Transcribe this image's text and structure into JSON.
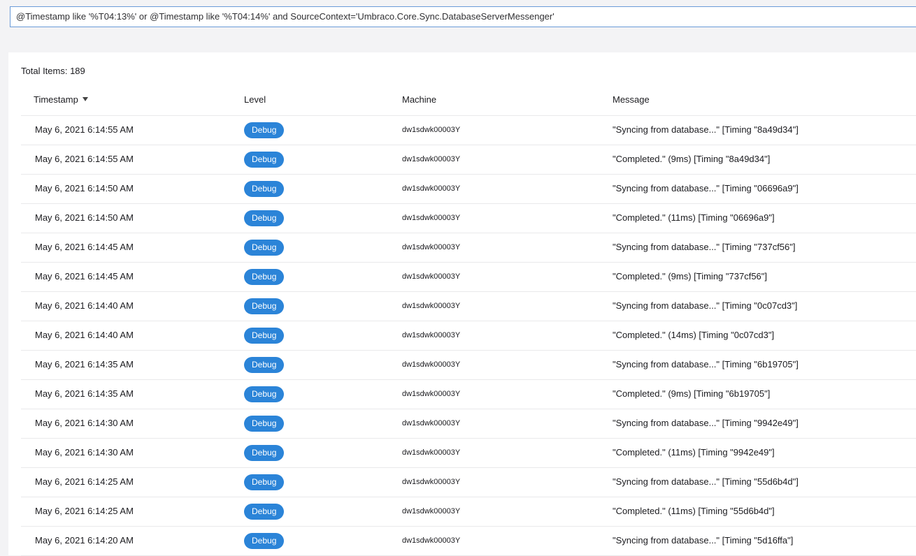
{
  "query": {
    "value": "@Timestamp like '%T04:13%' or @Timestamp like '%T04:14%' and SourceContext='Umbraco.Core.Sync.DatabaseServerMessenger'"
  },
  "total_items": "Total Items: 189",
  "columns": {
    "timestamp": "Timestamp",
    "level": "Level",
    "machine": "Machine",
    "message": "Message",
    "sort_icon": "caret-down-icon"
  },
  "colors": {
    "badge_debug": "#2b84d8",
    "query_border": "#6a9bd8"
  },
  "rows": [
    {
      "timestamp": "May 6, 2021 6:14:55 AM",
      "level": "Debug",
      "machine": "dw1sdwk00003Y",
      "message": "\"Syncing from database...\" [Timing \"8a49d34\"]"
    },
    {
      "timestamp": "May 6, 2021 6:14:55 AM",
      "level": "Debug",
      "machine": "dw1sdwk00003Y",
      "message": "\"Completed.\" (9ms) [Timing \"8a49d34\"]"
    },
    {
      "timestamp": "May 6, 2021 6:14:50 AM",
      "level": "Debug",
      "machine": "dw1sdwk00003Y",
      "message": "\"Syncing from database...\" [Timing \"06696a9\"]"
    },
    {
      "timestamp": "May 6, 2021 6:14:50 AM",
      "level": "Debug",
      "machine": "dw1sdwk00003Y",
      "message": "\"Completed.\" (11ms) [Timing \"06696a9\"]"
    },
    {
      "timestamp": "May 6, 2021 6:14:45 AM",
      "level": "Debug",
      "machine": "dw1sdwk00003Y",
      "message": "\"Syncing from database...\" [Timing \"737cf56\"]"
    },
    {
      "timestamp": "May 6, 2021 6:14:45 AM",
      "level": "Debug",
      "machine": "dw1sdwk00003Y",
      "message": "\"Completed.\" (9ms) [Timing \"737cf56\"]"
    },
    {
      "timestamp": "May 6, 2021 6:14:40 AM",
      "level": "Debug",
      "machine": "dw1sdwk00003Y",
      "message": "\"Syncing from database...\" [Timing \"0c07cd3\"]"
    },
    {
      "timestamp": "May 6, 2021 6:14:40 AM",
      "level": "Debug",
      "machine": "dw1sdwk00003Y",
      "message": "\"Completed.\" (14ms) [Timing \"0c07cd3\"]"
    },
    {
      "timestamp": "May 6, 2021 6:14:35 AM",
      "level": "Debug",
      "machine": "dw1sdwk00003Y",
      "message": "\"Syncing from database...\" [Timing \"6b19705\"]"
    },
    {
      "timestamp": "May 6, 2021 6:14:35 AM",
      "level": "Debug",
      "machine": "dw1sdwk00003Y",
      "message": "\"Completed.\" (9ms) [Timing \"6b19705\"]"
    },
    {
      "timestamp": "May 6, 2021 6:14:30 AM",
      "level": "Debug",
      "machine": "dw1sdwk00003Y",
      "message": "\"Syncing from database...\" [Timing \"9942e49\"]"
    },
    {
      "timestamp": "May 6, 2021 6:14:30 AM",
      "level": "Debug",
      "machine": "dw1sdwk00003Y",
      "message": "\"Completed.\" (11ms) [Timing \"9942e49\"]"
    },
    {
      "timestamp": "May 6, 2021 6:14:25 AM",
      "level": "Debug",
      "machine": "dw1sdwk00003Y",
      "message": "\"Syncing from database...\" [Timing \"55d6b4d\"]"
    },
    {
      "timestamp": "May 6, 2021 6:14:25 AM",
      "level": "Debug",
      "machine": "dw1sdwk00003Y",
      "message": "\"Completed.\" (11ms) [Timing \"55d6b4d\"]"
    },
    {
      "timestamp": "May 6, 2021 6:14:20 AM",
      "level": "Debug",
      "machine": "dw1sdwk00003Y",
      "message": "\"Syncing from database...\" [Timing \"5d16ffa\"]"
    }
  ]
}
